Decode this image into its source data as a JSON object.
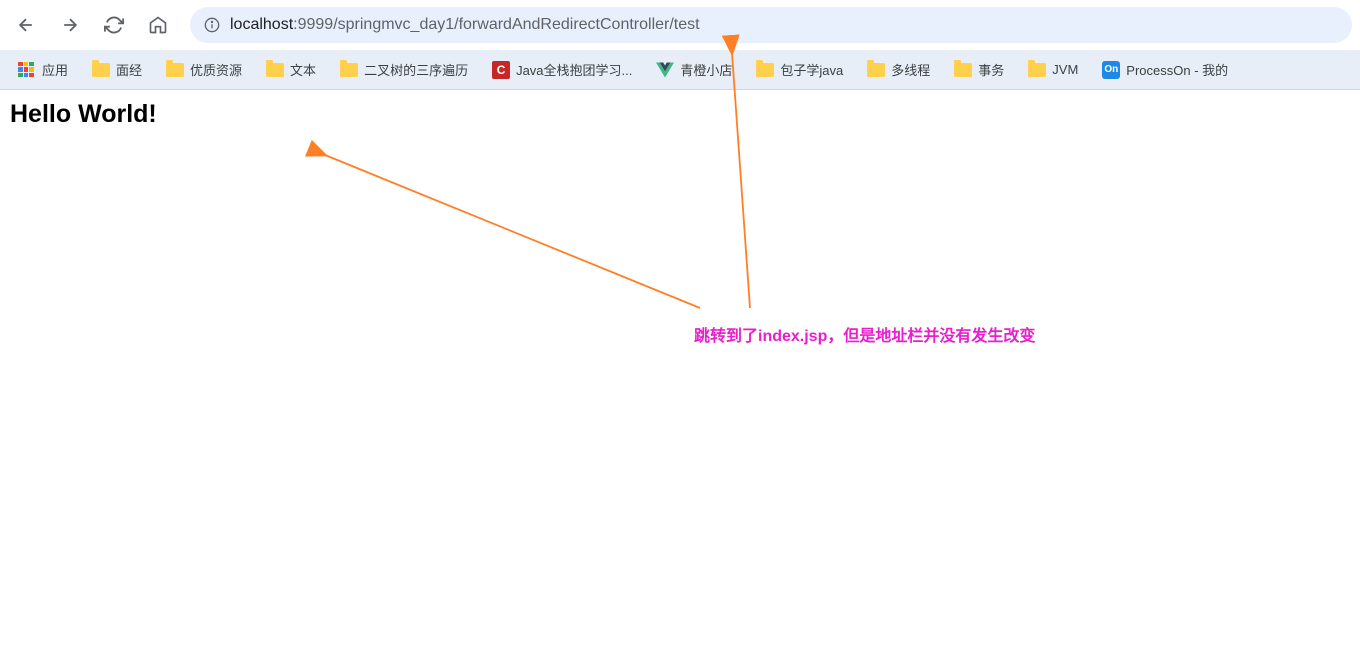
{
  "toolbar": {
    "url_host": "localhost",
    "url_path": ":9999/springmvc_day1/forwardAndRedirectController/test"
  },
  "bookmarks": {
    "apps_label": "应用",
    "items": [
      {
        "label": "面经",
        "icon": "folder"
      },
      {
        "label": "优质资源",
        "icon": "folder"
      },
      {
        "label": "文本",
        "icon": "folder"
      },
      {
        "label": "二叉树的三序遍历",
        "icon": "folder"
      },
      {
        "label": "Java全栈抱团学习...",
        "icon": "c"
      },
      {
        "label": "青橙小店",
        "icon": "vue"
      },
      {
        "label": "包子学java",
        "icon": "folder"
      },
      {
        "label": "多线程",
        "icon": "folder"
      },
      {
        "label": "事务",
        "icon": "folder"
      },
      {
        "label": "JVM",
        "icon": "folder"
      },
      {
        "label": "ProcessOn - 我的",
        "icon": "on"
      }
    ]
  },
  "page": {
    "heading": "Hello World!"
  },
  "annotation": {
    "text": "跳转到了index.jsp，但是地址栏并没有发生改变"
  }
}
